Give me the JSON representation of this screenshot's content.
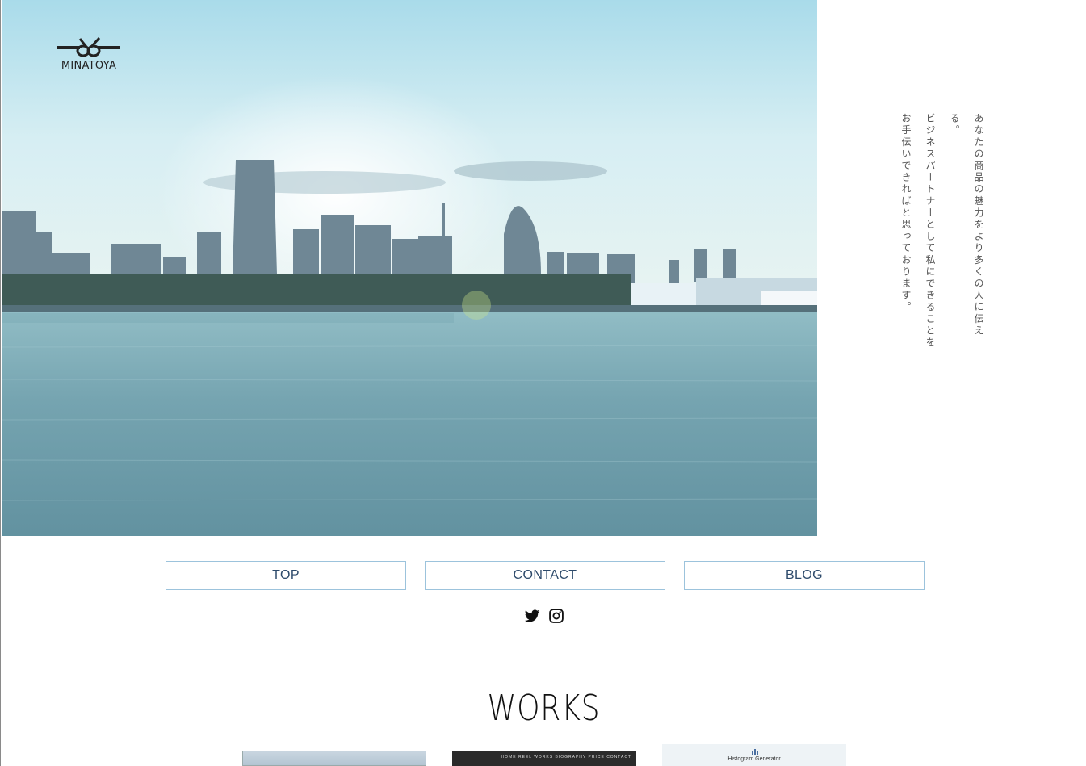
{
  "brand": {
    "name": "MINATOYA"
  },
  "hero": {
    "alt": "",
    "tagline": [
      "あなたの商品の魅力をより多くの人に伝える。",
      "ビジネスパートナーとして私にできることを",
      "お手伝いできればと思っております。"
    ]
  },
  "nav": {
    "items": [
      {
        "label": "TOP"
      },
      {
        "label": "CONTACT"
      },
      {
        "label": "BLOG"
      }
    ]
  },
  "social": {
    "icons": [
      "twitter-icon",
      "instagram-icon"
    ]
  },
  "works": {
    "title": "WORKS",
    "items": [
      {
        "menu": ""
      },
      {
        "menu": "HOME    REEL    WORKS    BIOGRAPHY    PRICE    CONTACT"
      },
      {
        "title": "Histogram Generator"
      }
    ]
  },
  "colors": {
    "nav_border": "#9cc3dc",
    "nav_text": "#2d4a6b"
  }
}
